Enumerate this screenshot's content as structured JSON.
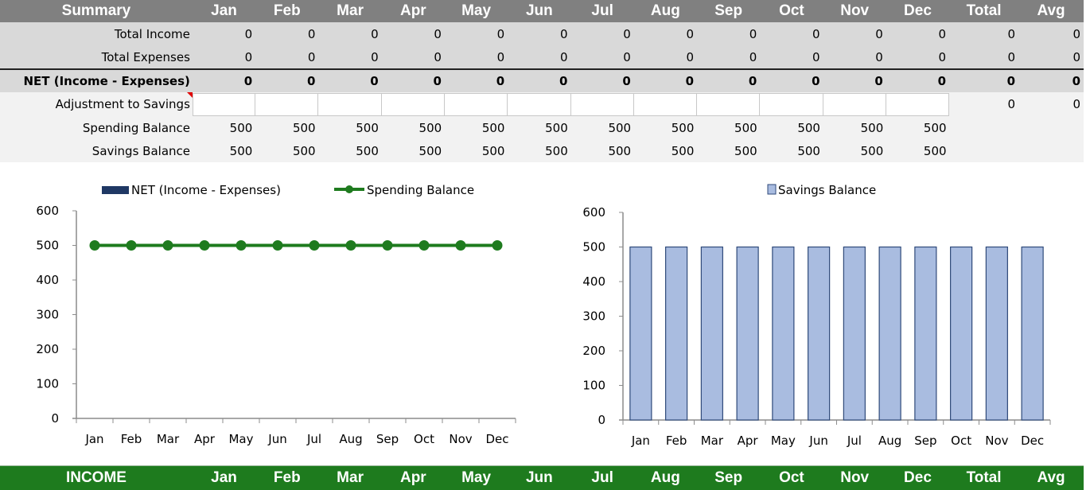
{
  "summary": {
    "header": {
      "title": "Summary",
      "months": [
        "Jan",
        "Feb",
        "Mar",
        "Apr",
        "May",
        "Jun",
        "Jul",
        "Aug",
        "Sep",
        "Oct",
        "Nov",
        "Dec"
      ],
      "total": "Total",
      "avg": "Avg"
    },
    "rows": {
      "total_income": {
        "label": "Total Income",
        "values": [
          "0",
          "0",
          "0",
          "0",
          "0",
          "0",
          "0",
          "0",
          "0",
          "0",
          "0",
          "0"
        ],
        "total": "0",
        "avg": "0"
      },
      "total_expenses": {
        "label": "Total Expenses",
        "values": [
          "0",
          "0",
          "0",
          "0",
          "0",
          "0",
          "0",
          "0",
          "0",
          "0",
          "0",
          "0"
        ],
        "total": "0",
        "avg": "0"
      },
      "net": {
        "label": "NET (Income - Expenses)",
        "values": [
          "0",
          "0",
          "0",
          "0",
          "0",
          "0",
          "0",
          "0",
          "0",
          "0",
          "0",
          "0"
        ],
        "total": "0",
        "avg": "0"
      },
      "adjustment": {
        "label": "Adjustment to Savings",
        "values": [
          "",
          "",
          "",
          "",
          "",
          "",
          "",
          "",
          "",
          "",
          "",
          ""
        ],
        "total": "0",
        "avg": "0"
      },
      "spending_balance": {
        "label": "Spending Balance",
        "values": [
          "500",
          "500",
          "500",
          "500",
          "500",
          "500",
          "500",
          "500",
          "500",
          "500",
          "500",
          "500"
        ]
      },
      "savings_balance": {
        "label": "Savings Balance",
        "values": [
          "500",
          "500",
          "500",
          "500",
          "500",
          "500",
          "500",
          "500",
          "500",
          "500",
          "500",
          "500"
        ]
      }
    }
  },
  "colors": {
    "header_bg": "#808080",
    "row_dark": "#d9d9d9",
    "row_light": "#f2f2f2",
    "income_bar": "#1e7b1e",
    "net_series": "#1f3864",
    "spending_line": "#1e7b1e",
    "savings_bar_fill": "#a9bce0",
    "savings_bar_stroke": "#2f4a7a",
    "comment_flag": "#e00000"
  },
  "chart_data": [
    {
      "type": "line",
      "title": "",
      "legend_position": "top",
      "legend": [
        "NET (Income - Expenses)",
        "Spending Balance"
      ],
      "categories": [
        "Jan",
        "Feb",
        "Mar",
        "Apr",
        "May",
        "Jun",
        "Jul",
        "Aug",
        "Sep",
        "Oct",
        "Nov",
        "Dec"
      ],
      "series": [
        {
          "name": "NET (Income - Expenses)",
          "kind": "bar",
          "values": [
            0,
            0,
            0,
            0,
            0,
            0,
            0,
            0,
            0,
            0,
            0,
            0
          ]
        },
        {
          "name": "Spending Balance",
          "kind": "line",
          "values": [
            500,
            500,
            500,
            500,
            500,
            500,
            500,
            500,
            500,
            500,
            500,
            500
          ]
        }
      ],
      "ylim": [
        0,
        600
      ],
      "yticks": [
        0,
        100,
        200,
        300,
        400,
        500,
        600
      ],
      "xlabel": "",
      "ylabel": "",
      "grid": false
    },
    {
      "type": "bar",
      "title": "",
      "legend_position": "top",
      "legend": [
        "Savings Balance"
      ],
      "categories": [
        "Jan",
        "Feb",
        "Mar",
        "Apr",
        "May",
        "Jun",
        "Jul",
        "Aug",
        "Sep",
        "Oct",
        "Nov",
        "Dec"
      ],
      "series": [
        {
          "name": "Savings Balance",
          "values": [
            500,
            500,
            500,
            500,
            500,
            500,
            500,
            500,
            500,
            500,
            500,
            500
          ]
        }
      ],
      "ylim": [
        0,
        600
      ],
      "yticks": [
        0,
        100,
        200,
        300,
        400,
        500,
        600
      ],
      "xlabel": "",
      "ylabel": "",
      "grid": false
    }
  ],
  "income": {
    "title": "INCOME",
    "months": [
      "Jan",
      "Feb",
      "Mar",
      "Apr",
      "May",
      "Jun",
      "Jul",
      "Aug",
      "Sep",
      "Oct",
      "Nov",
      "Dec"
    ],
    "total": "Total",
    "avg": "Avg"
  }
}
